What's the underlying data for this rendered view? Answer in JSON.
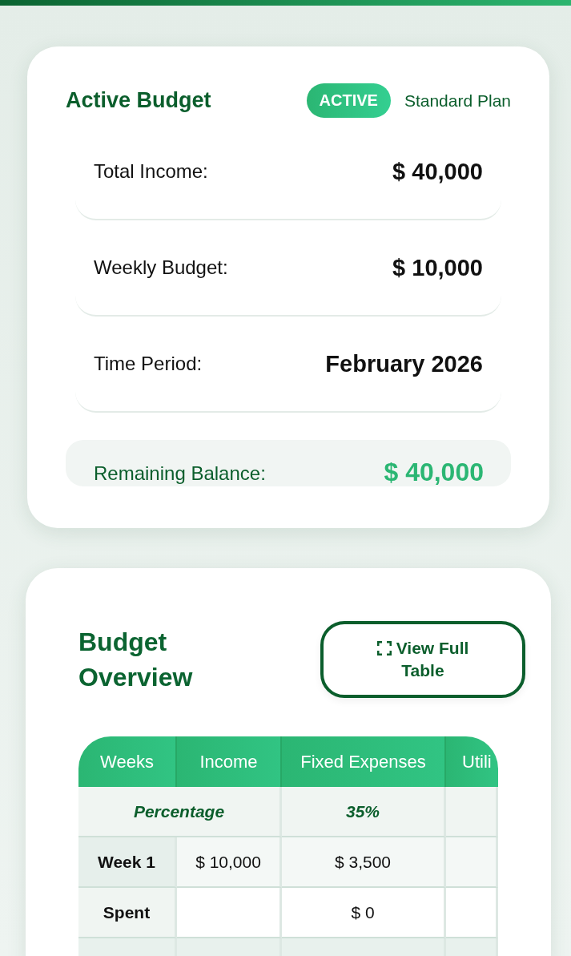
{
  "budget_card": {
    "title": "Active Budget",
    "status_badge": "ACTIVE",
    "plan": "Standard Plan",
    "rows": [
      {
        "label": "Total Income:",
        "value": "$ 40,000"
      },
      {
        "label": "Weekly Budget:",
        "value": "$ 10,000"
      },
      {
        "label": "Time Period:",
        "value": "February 2026"
      }
    ],
    "remaining": {
      "label": "Remaining Balance:",
      "value": "$ 40,000"
    }
  },
  "overview": {
    "title": "Budget Overview",
    "view_button": "View Full Table",
    "table": {
      "columns": [
        "Weeks",
        "Income",
        "Fixed Expenses",
        "Utili"
      ],
      "rows": [
        {
          "kind": "percentage",
          "label": "Percentage",
          "fixed_expenses": "35%"
        },
        {
          "kind": "week",
          "label": "Week 1",
          "income": "$ 10,000",
          "fixed_expenses": "$ 3,500"
        },
        {
          "kind": "spent",
          "label": "Spent",
          "fixed_expenses": "$ 0"
        },
        {
          "kind": "blank"
        }
      ]
    }
  }
}
